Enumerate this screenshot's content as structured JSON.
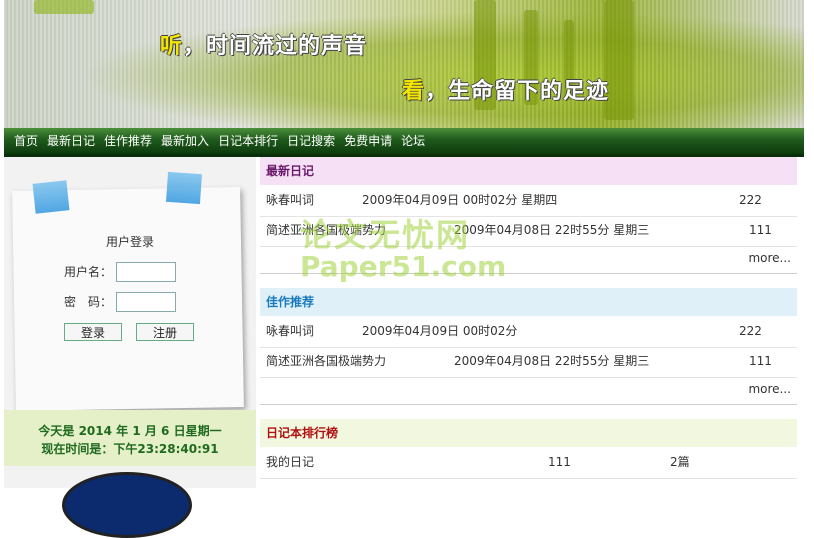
{
  "banner": {
    "tagline_1_hl": "听",
    "tagline_1_rest": "，时间流过的声音",
    "tagline_2_hl": "看",
    "tagline_2_rest": "，生命留下的足迹"
  },
  "nav": {
    "items": [
      "首页",
      "最新日记",
      "佳作推荐",
      "最新加入",
      "日记本排行",
      "日记搜索",
      "免费申请",
      "论坛"
    ]
  },
  "login": {
    "title": "用户登录",
    "username_label": "用户名：",
    "password_label": "密　码：",
    "login_button": "登录",
    "register_button": "注册"
  },
  "datebox": {
    "today": "今天是 2014 年 1 月 6 日星期一",
    "now": "现在时间是：下午23:28:40:91"
  },
  "latest": {
    "title": "最新日记",
    "rows": [
      {
        "name": "咏春叫词",
        "time": "2009年04月09日 00时02分 星期四",
        "count": "222"
      },
      {
        "name": "简述亚洲各国极端势力",
        "time": "2009年04月08日 22时55分 星期三",
        "count": "111"
      }
    ],
    "more": "more..."
  },
  "recommended": {
    "title": "佳作推荐",
    "rows": [
      {
        "name": "咏春叫词",
        "time": "2009年04月09日 00时02分",
        "count": "222"
      },
      {
        "name": "简述亚洲各国极端势力",
        "time": "2009年04月08日 22时55分 星期三",
        "count": "111"
      }
    ],
    "more": "more..."
  },
  "ranking": {
    "title": "日记本排行榜",
    "rows": [
      {
        "name": "我的日记",
        "count": "111",
        "posts": "2篇"
      }
    ]
  },
  "watermark": {
    "line1": "论文无忧网",
    "line2": "Paper51.com"
  },
  "colors": {
    "latest_head_bg": "#f6e0f6",
    "latest_head_fg": "#6a1a6a",
    "recommended_head_bg": "#dff0f8",
    "recommended_head_fg": "#1a7abf",
    "ranking_head_bg": "#f2f7e0",
    "ranking_head_fg": "#b01010"
  }
}
